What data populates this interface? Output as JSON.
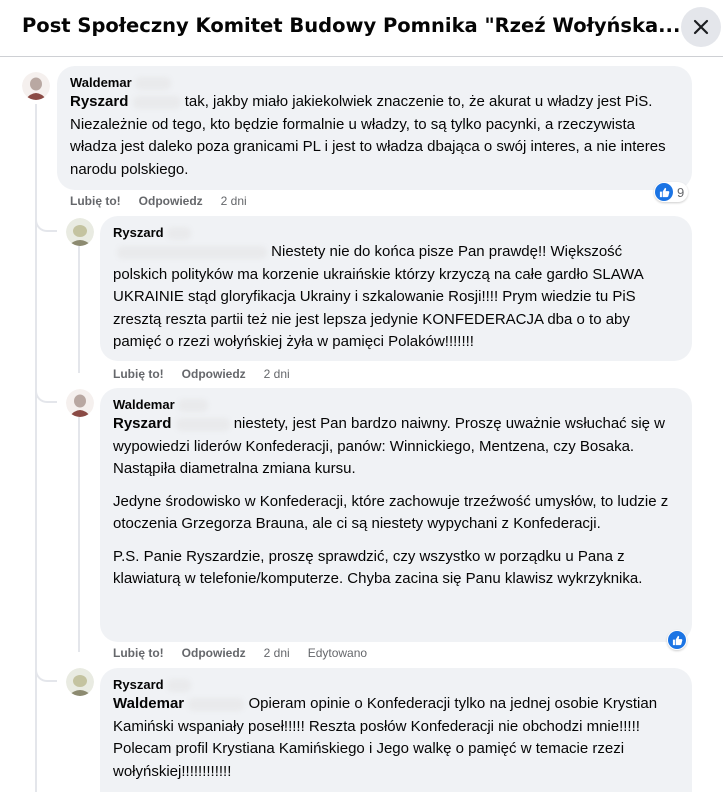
{
  "header": {
    "title": "Post Społeczny Komitet Budowy Pomnika \"Rzeź Wołyńska...",
    "close_icon": "close-icon"
  },
  "colors": {
    "bubble": "#f0f2f5",
    "meta_text": "#65676b",
    "like_blue": "#1b74e4"
  },
  "actions": {
    "like": "Lubię to!",
    "reply": "Odpowiedz"
  },
  "comments": [
    {
      "author": "Waldemar",
      "mention": "Ryszard",
      "paragraphs": [
        "tak, jakby miało jakiekolwiek znaczenie to, że akurat u władzy jest PiS. Niezależnie od tego, kto będzie formalnie u władzy, to są tylko pacynki, a rzeczywista władza jest daleko poza granicami PL i jest to władza dbająca o swój interes, a nie interes narodu polskiego."
      ],
      "time": "2 dni",
      "reaction_icon": "like-icon",
      "reaction_count": "9"
    },
    {
      "author": "Ryszard",
      "mention": "",
      "paragraphs": [
        "Niestety nie do końca pisze Pan prawdę!! Większość polskich polityków ma korzenie ukraińskie którzy krzyczą na całe gardło SLAWA UKRAINIE stąd gloryfikacja Ukrainy i szkalowanie Rosji!!!! Prym wiedzie tu PiS zresztą reszta partii też nie jest lepsza jedynie KONFEDERACJA dba o to aby pamięć o rzezi wołyńskiej żyła w pamięci Polaków!!!!!!!"
      ],
      "time": "2 dni"
    },
    {
      "author": "Waldemar",
      "mention": "Ryszard",
      "paragraphs": [
        "niestety, jest Pan bardzo naiwny. Proszę uważnie wsłuchać się w wypowiedzi liderów Konfederacji, panów: Winnickiego, Mentzena, czy Bosaka. Nastąpiła diametralna zmiana kursu.",
        "Jedyne środowisko w Konfederacji, które zachowuje trzeźwość umysłów, to ludzie z otoczenia Grzegorza Brauna, ale ci są niestety wypychani z Konfederacji.",
        "P.S. Panie Ryszardzie, proszę sprawdzić, czy wszystko w porządku u Pana z klawiaturą w telefonie/komputerze. Chyba zacina się Panu klawisz wykrzyknika."
      ],
      "time": "2 dni",
      "edited": "Edytowano",
      "reaction_icon": "like-icon"
    },
    {
      "author": "Ryszard",
      "mention": "Waldemar",
      "paragraphs": [
        "Opieram opinie o Konfederacji tylko na jednej osobie Krystian Kamiński wspaniały poseł!!!!! Reszta posłów Konfederacji nie obchodzi mnie!!!!! Polecam profil Krystiana Kamińskiego i Jego walkę o pamięć w temacie rzezi wołyńskiej!!!!!!!!!!!!"
      ]
    }
  ]
}
